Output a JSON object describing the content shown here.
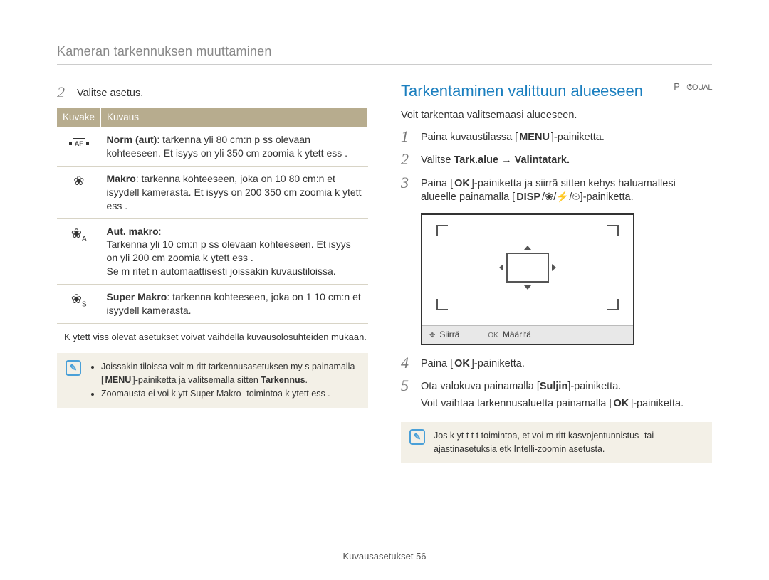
{
  "header": "Kameran tarkennuksen muuttaminen",
  "left": {
    "step2": {
      "num": "2",
      "text": "Valitse asetus."
    },
    "table": {
      "th_icon": "Kuvake",
      "th_desc": "Kuvaus",
      "rows": [
        {
          "icon_name": "af-normal-icon",
          "desc_bold": "Norm (aut)",
          "desc": ": tarkenna yli 80 cm:n p  ss  olevaan kohteeseen. Et isyys on yli 350 cm zoomia k ytett ess ."
        },
        {
          "icon_name": "flower-icon",
          "glyph": "❀",
          "desc_bold": "Makro",
          "desc": ": tarkenna kohteeseen, joka on 10 80 cm:n et isyydell  kamerasta. Et isyys on 200 350 cm zoomia k ytett ess ."
        },
        {
          "icon_name": "auto-macro-icon",
          "glyph": "❀",
          "sub": "A",
          "desc_bold": "Aut. makro",
          "desc": ":\nTarkenna yli 10 cm:n p  ss  olevaan kohteeseen. Et isyys on yli 200 cm zoomia k ytett ess .\nSe m  ritet  n automaattisesti joissakin kuvaustiloissa."
        },
        {
          "icon_name": "super-macro-icon",
          "glyph": "❀",
          "sub": "S",
          "desc_bold": "Super Makro",
          "desc": ": tarkenna kohteeseen, joka on 1 10 cm:n et isyydell  kamerasta."
        }
      ]
    },
    "note": "K ytett viss  olevat asetukset voivat vaihdella kuvausolosuhteiden mukaan.",
    "tip": {
      "line1a": "Joissakin tiloissa voit m  ritt   tarkennusasetuksen my s painamalla [",
      "line1b": "MENU",
      "line1c": "]-painiketta ja valitsemalla sitten ",
      "line1d": "Tarkennus",
      "line1e": ".",
      "line2": "Zoomausta ei voi k ytt   Super Makro -toimintoa k ytett ess ."
    }
  },
  "right": {
    "title": "Tarkentaminen valittuun alueeseen",
    "mode_p": "P",
    "mode_dual": "DUAL",
    "intro": "Voit tarkentaa valitsemaasi alueeseen.",
    "s1": {
      "num": "1",
      "a": "Paina kuvaustilassa [",
      "b": "MENU",
      "c": "]-painiketta."
    },
    "s2": {
      "num": "2",
      "a": "Valitse ",
      "b": "Tark.alue",
      "arrow": " → ",
      "c": "Valintatark."
    },
    "s3": {
      "num": "3",
      "a": "Paina [",
      "ok": "OK",
      "b": "]-painiketta ja siirrä sitten kehys haluamallesi alueelle painamalla [",
      "disp": "DISP",
      "s1": "/",
      "i1": "❀",
      "s2": "/",
      "i2": "⚡",
      "s3": "/",
      "i3": "⏲",
      "c": "]-painiketta."
    },
    "lcd": {
      "move": "Siirrä",
      "set": "Määritä"
    },
    "s4": {
      "num": "4",
      "a": "Paina [",
      "ok": "OK",
      "b": "]-painiketta."
    },
    "s5": {
      "num": "5",
      "a": "Ota valokuva painamalla [",
      "b": "Suljin",
      "c": "]-painiketta."
    },
    "sub5": {
      "a": "Voit vaihtaa tarkennusaluetta painamalla [",
      "ok": "OK",
      "b": "]-painiketta."
    },
    "tip": "Jos k yt t t t  toimintoa, et voi m  ritt   kasvojentunnistus- tai ajastinasetuksia etk  Intelli-zoomin asetusta."
  },
  "footer": {
    "label": "Kuvausasetukset",
    "page": "56"
  }
}
